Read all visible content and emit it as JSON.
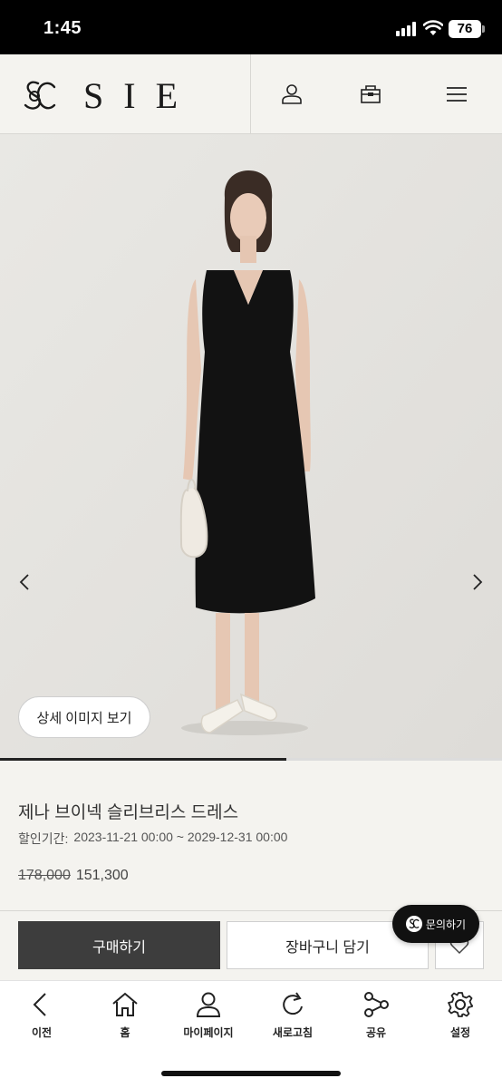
{
  "status_bar": {
    "time": "1:45",
    "battery": "76"
  },
  "header": {
    "brand": "SIE",
    "icons": [
      "user-icon",
      "shopping-bag-icon",
      "menu-icon"
    ]
  },
  "gallery": {
    "detail_button": "상세 이미지 보기",
    "progress": 0.57
  },
  "product": {
    "name": "제나 브이넥 슬리브리스 드레스",
    "period_label": "할인기간:",
    "period_value": "2023-11-21 00:00 ~ 2029-12-31 00:00",
    "price_original": "178,000",
    "price_sale": "151,300"
  },
  "actions": {
    "buy": "구매하기",
    "cart": "장바구니 담기",
    "inquiry": "문의하기"
  },
  "bottom_nav": {
    "back": "이전",
    "home": "홈",
    "mypage": "마이페이지",
    "refresh": "새로고침",
    "share": "공유",
    "settings": "설정"
  }
}
